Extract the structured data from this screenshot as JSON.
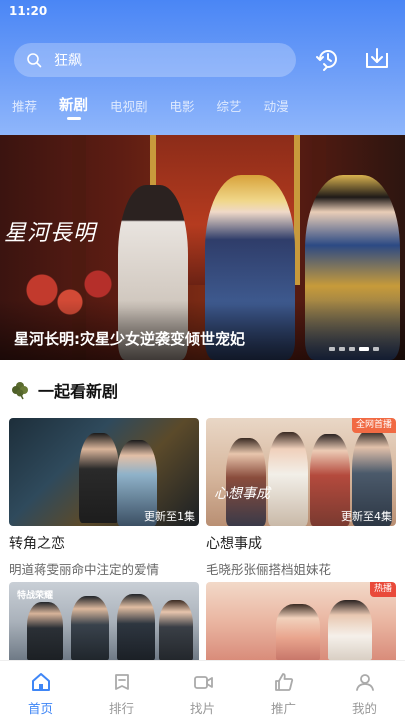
{
  "status_bar": {
    "time": "11:20"
  },
  "search": {
    "query": "狂飙"
  },
  "header": {
    "icons": [
      "history-icon",
      "download-icon"
    ]
  },
  "tabs": [
    {
      "label": "推荐",
      "active": false
    },
    {
      "label": "新剧",
      "active": true
    },
    {
      "label": "电视剧",
      "active": false
    },
    {
      "label": "电影",
      "active": false
    },
    {
      "label": "综艺",
      "active": false
    },
    {
      "label": "动漫",
      "active": false
    }
  ],
  "banner": {
    "calligraphy": "星河長明",
    "title": "星河长明:灾星少女逆袭变倾世宠妃",
    "slides": 5,
    "active_slide": 4
  },
  "section": {
    "title": "一起看新剧",
    "icon": "clover-icon"
  },
  "cards": [
    {
      "title": "转角之恋",
      "subtitle": "明道蒋雯丽命中注定的爱情",
      "badge": "更新至1集"
    },
    {
      "title": "心想事成",
      "subtitle": "毛晓彤张俪搭档姐妹花",
      "badge": "更新至4集",
      "corner": "全网首播",
      "thumb_text": "心想事成"
    },
    {
      "title": "",
      "subtitle": "",
      "badge": "",
      "thumb_text": "特战荣耀"
    },
    {
      "title": "",
      "subtitle": "",
      "badge": "",
      "corner": "热播"
    }
  ],
  "tabbar": [
    {
      "label": "首页",
      "icon": "home-icon",
      "active": true
    },
    {
      "label": "排行",
      "icon": "ranking-icon",
      "active": false
    },
    {
      "label": "找片",
      "icon": "video-camera-icon",
      "active": false
    },
    {
      "label": "推广",
      "icon": "thumbs-up-icon",
      "active": false
    },
    {
      "label": "我的",
      "icon": "user-icon",
      "active": false
    }
  ],
  "colors": {
    "accent": "#3f86f6",
    "header_top": "#4a86f5",
    "inactive": "#999999"
  }
}
